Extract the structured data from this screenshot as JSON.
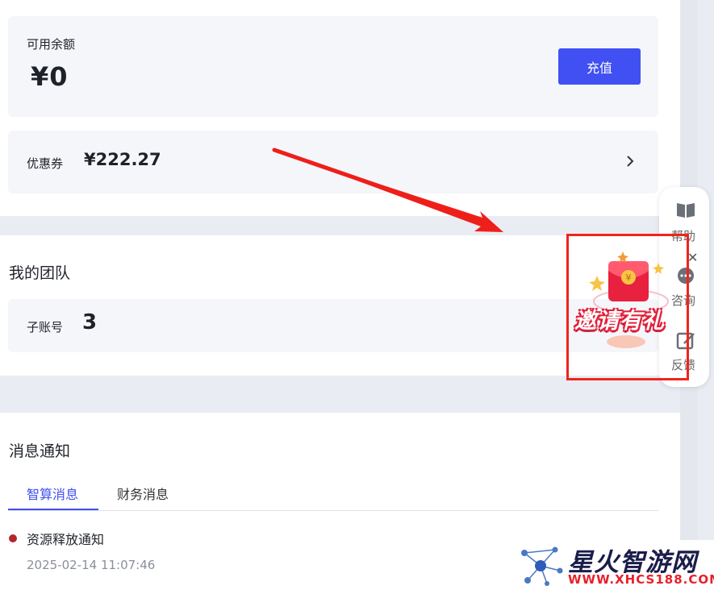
{
  "account": {
    "balance_label": "可用余额",
    "balance_value": "¥0",
    "recharge_label": "充值",
    "coupon_label": "优惠券",
    "coupon_value": "¥222.27"
  },
  "team": {
    "title": "我的团队",
    "sub_account_label": "子账号",
    "sub_account_count": "3"
  },
  "messages": {
    "title": "消息通知",
    "tabs": [
      {
        "label": "智算消息",
        "active": true
      },
      {
        "label": "财务消息",
        "active": false
      }
    ],
    "items": [
      {
        "title": "资源释放通知",
        "time": "2025-02-14 11:07:46",
        "status_color": "#b3262d"
      }
    ]
  },
  "side_toolbar": {
    "items": [
      {
        "label": "帮助",
        "icon": "book-icon"
      },
      {
        "label": "咨询",
        "icon": "chat-icon"
      },
      {
        "label": "反馈",
        "icon": "feedback-icon"
      }
    ],
    "close_symbol": "✕"
  },
  "promo": {
    "text": "邀请有礼",
    "icon": "red-envelope-icon"
  },
  "watermark": {
    "name": "星火智游网",
    "url": "WWW.XHCS188.COM"
  },
  "colors": {
    "accent": "#4050f2",
    "highlight_border": "#f0241c",
    "page_bg": "#e9ecf3"
  }
}
